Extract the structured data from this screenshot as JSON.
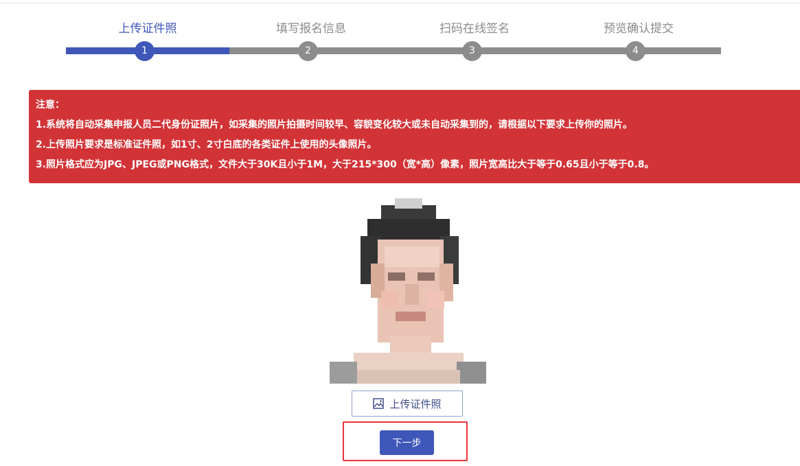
{
  "steps": [
    {
      "label": "上传证件照",
      "number": "1",
      "active": true
    },
    {
      "label": "填写报名信息",
      "number": "2",
      "active": false
    },
    {
      "label": "扫码在线签名",
      "number": "3",
      "active": false
    },
    {
      "label": "预览确认提交",
      "number": "4",
      "active": false
    }
  ],
  "notice": {
    "title": "注意：",
    "lines": [
      "1.系统将自动采集申报人员二代身份证照片，如采集的照片拍摄时间较早、容貌变化较大或未自动采集到的，请根据以下要求上传你的照片。",
      "2.上传照片要求是标准证件照，如1寸、2寸白底的各类证件上使用的头像照片。",
      "3.照片格式应为JPG、JPEG或PNG格式，文件大于30K且小于1M，大于215*300（宽*高）像素，照片宽高比大于等于0.65且小于等于0.8。"
    ]
  },
  "photo": {
    "icon": "id-photo-pixelated"
  },
  "upload_button": {
    "label": "上传证件照",
    "icon": "image-icon"
  },
  "next_button": {
    "label": "下一步"
  },
  "colors": {
    "primary": "#3f57b8",
    "notice_bg": "#d23337",
    "inactive": "#8c8c8c",
    "highlight": "#e6323a"
  }
}
